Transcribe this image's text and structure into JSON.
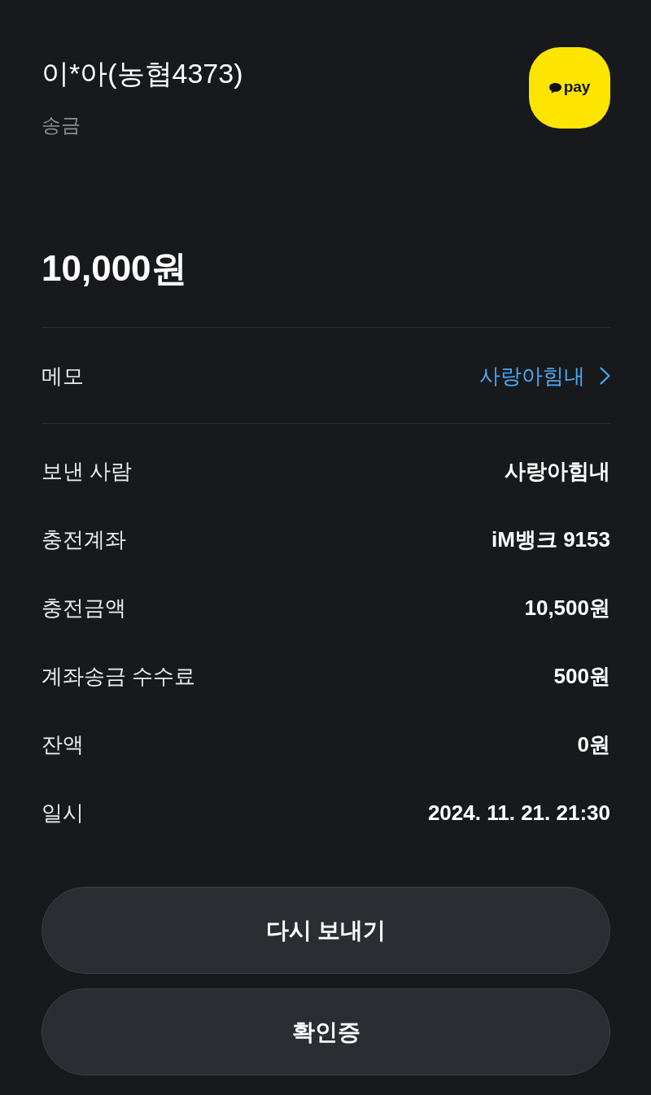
{
  "header": {
    "title": "이*아(농협4373)",
    "subtitle": "송금",
    "logo_text": "pay"
  },
  "amount": "10,000원",
  "memo": {
    "label": "메모",
    "value": "사랑아힘내"
  },
  "details": [
    {
      "label": "보낸 사람",
      "value": "사랑아힘내"
    },
    {
      "label": "충전계좌",
      "value": "iM뱅크 9153"
    },
    {
      "label": "충전금액",
      "value": "10,500원"
    },
    {
      "label": "계좌송금 수수료",
      "value": "500원"
    },
    {
      "label": "잔액",
      "value": "0원"
    },
    {
      "label": "일시",
      "value": "2024. 11. 21. 21:30"
    }
  ],
  "buttons": [
    "다시 보내기",
    "확인증"
  ]
}
